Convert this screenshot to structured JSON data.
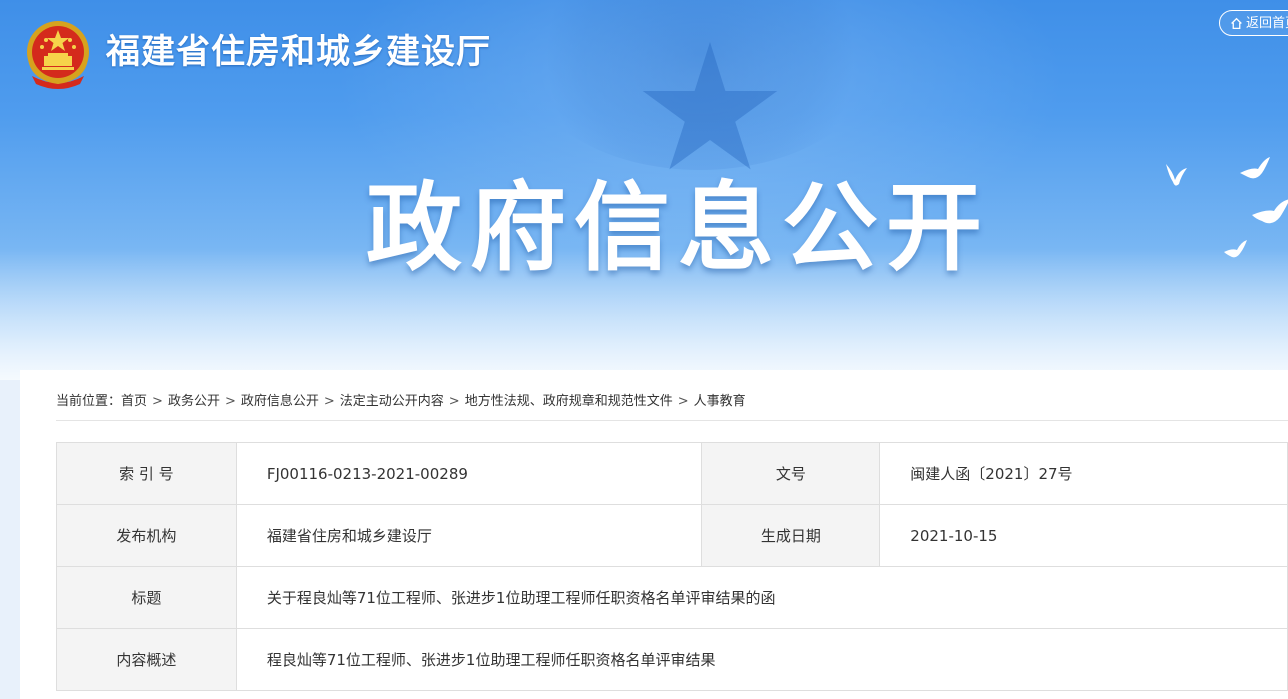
{
  "header": {
    "site_title": "福建省住房和城乡建设厅",
    "home_button": "返回首页",
    "banner_title": "政府信息公开"
  },
  "breadcrumb": {
    "prefix": "当前位置：",
    "items": [
      "首页",
      "政务公开",
      "政府信息公开",
      "法定主动公开内容",
      "地方性法规、政府规章和规范性文件",
      "人事教育"
    ],
    "separator": ">"
  },
  "meta": {
    "index_label": "索 引 号",
    "index_value": "FJ00116-0213-2021-00289",
    "doc_no_label": "文号",
    "doc_no_value": "闽建人函〔2021〕27号",
    "publisher_label": "发布机构",
    "publisher_value": "福建省住房和城乡建设厅",
    "date_label": "生成日期",
    "date_value": "2021-10-15",
    "title_label": "标题",
    "title_value": "关于程良灿等71位工程师、张进步1位助理工程师任职资格名单评审结果的函",
    "summary_label": "内容概述",
    "summary_value": "程良灿等71位工程师、张进步1位助理工程师任职资格名单评审结果"
  },
  "colors": {
    "banner_top": "#3f8fe8",
    "banner_bottom": "#e6f2fd",
    "label_bg": "#f4f4f4",
    "border": "#dedede"
  }
}
